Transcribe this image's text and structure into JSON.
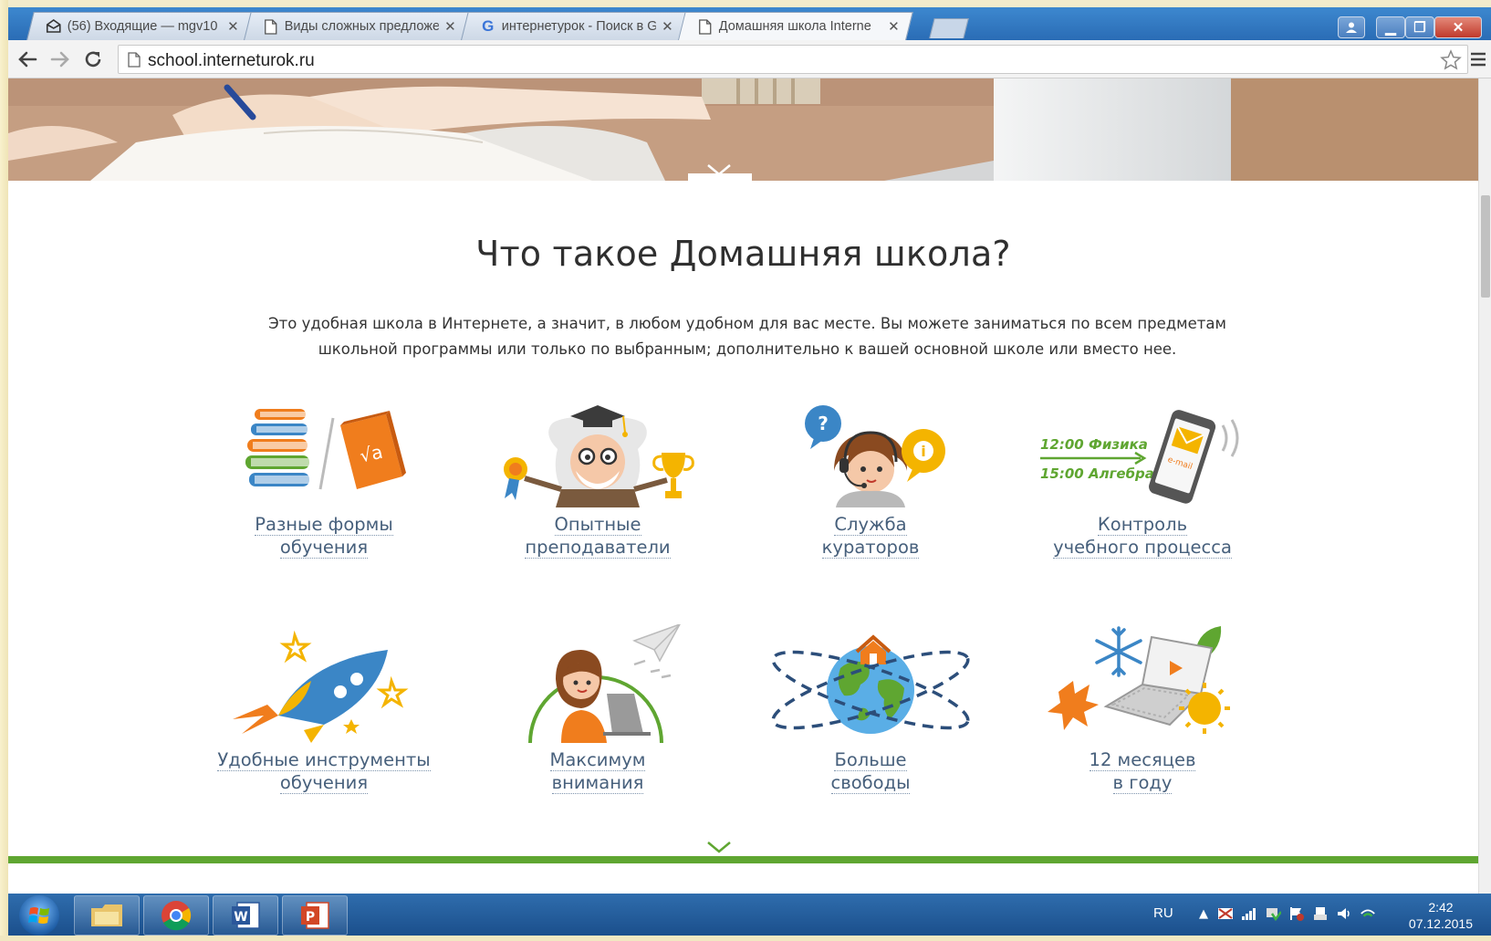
{
  "browser": {
    "tabs": [
      {
        "title": "(56) Входящие — mgv10",
        "icon": "mail-icon"
      },
      {
        "title": "Виды сложных предложе",
        "icon": "page-icon"
      },
      {
        "title": "интернетурок - Поиск в G",
        "icon": "google-icon"
      },
      {
        "title": "Домашняя школа Interne",
        "icon": "page-icon",
        "active": true
      }
    ],
    "url": "school.interneturok.ru"
  },
  "page": {
    "title": "Что такое Домашняя школа?",
    "intro_line1": "Это удобная школа в Интернете, а значит, в любом удобном для вас месте. Вы можете заниматься по всем предметам",
    "intro_line2": "школьной программы или только по выбранным; дополнительно к вашей основной школе или вместо нее.",
    "features": [
      {
        "line1": "Разные формы",
        "line2": "обучения",
        "icon": "books-icon"
      },
      {
        "line1": "Опытные",
        "line2": "преподаватели",
        "icon": "professor-icon"
      },
      {
        "line1": "Служба",
        "line2": "кураторов",
        "icon": "curator-icon"
      },
      {
        "line1": "Контроль",
        "line2": "учебного процесса",
        "icon": "phone-schedule-icon"
      },
      {
        "line1": "Удобные инструменты",
        "line2": "обучения",
        "icon": "rocket-icon"
      },
      {
        "line1": "Максимум",
        "line2": "внимания",
        "icon": "student-laptop-icon"
      },
      {
        "line1": "Больше",
        "line2": "свободы",
        "icon": "globe-icon"
      },
      {
        "line1": "12 месяцев",
        "line2": "в году",
        "icon": "seasons-laptop-icon"
      }
    ],
    "schedule": {
      "row1": "12:00 Физика",
      "row2": "15:00 Алгебра",
      "email_label": "e-mail"
    },
    "math_symbol": "√a"
  },
  "taskbar": {
    "language": "RU",
    "time": "2:42",
    "date": "07.12.2015"
  },
  "colors": {
    "link": "#47607c",
    "accent_green": "#5fa631",
    "orange": "#f07d1d",
    "blue": "#3b86c6"
  }
}
